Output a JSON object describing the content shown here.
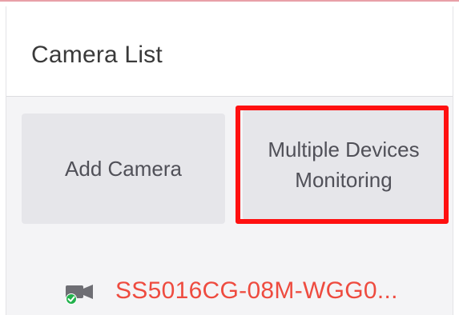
{
  "header": {
    "title": "Camera List"
  },
  "actions": {
    "add_camera_label": "Add Camera",
    "multi_monitor_line1": "Multiple Devices",
    "multi_monitor_line2": "Monitoring"
  },
  "cameras": [
    {
      "name": "SS5016CG-08M-WGG0...",
      "icon": "camera-icon",
      "status": "online",
      "status_icon": "check-circle-icon"
    }
  ],
  "colors": {
    "accent_red": "#ee4b3f",
    "highlight_box": "#ff1010",
    "status_green": "#22b14c",
    "button_bg": "#e6e6ea"
  }
}
